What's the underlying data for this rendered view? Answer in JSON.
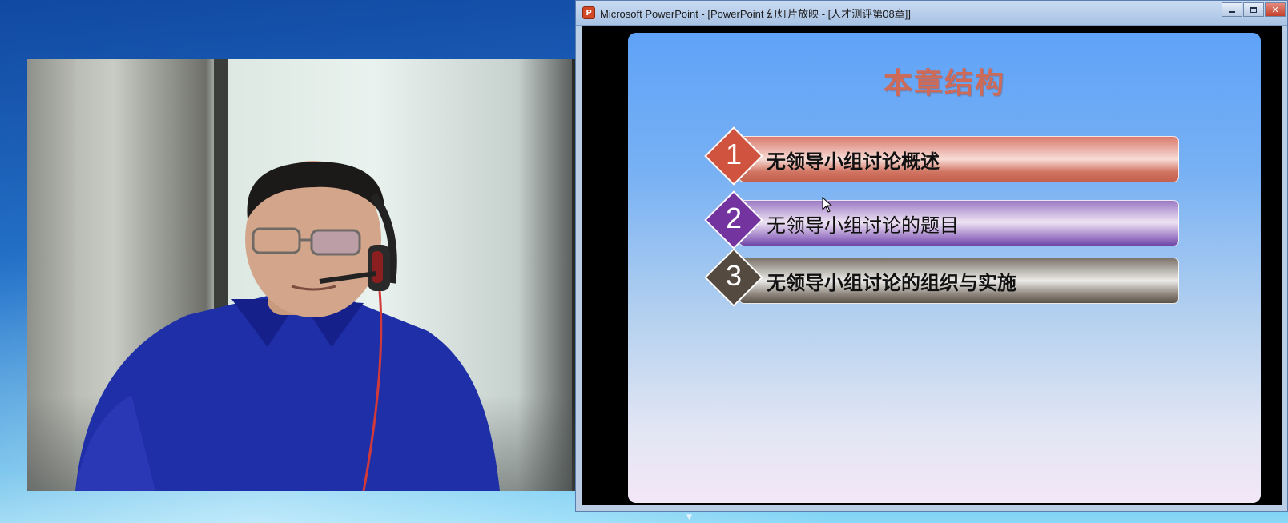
{
  "window": {
    "title": "Microsoft PowerPoint - [PowerPoint 幻灯片放映 - [人才测评第08章]]",
    "app_icon": "powerpoint-icon",
    "controls": [
      "minimize-icon",
      "maximize-icon",
      "close-icon"
    ]
  },
  "slide": {
    "title": "本章结构",
    "items": [
      {
        "number": "1",
        "label": "无领导小组讨论概述",
        "color": "#d0533f"
      },
      {
        "number": "2",
        "label": "无领导小组讨论的题目",
        "color": "#7434a0"
      },
      {
        "number": "3",
        "label": "无领导小组讨论的组织与实施",
        "color": "#544a40"
      }
    ]
  },
  "webcam": {
    "subject": "presenter-video"
  },
  "colors": {
    "slide_title": "#ce6a58",
    "desktop_blue": "#2e86de",
    "titlebar": "#b9cde5"
  }
}
